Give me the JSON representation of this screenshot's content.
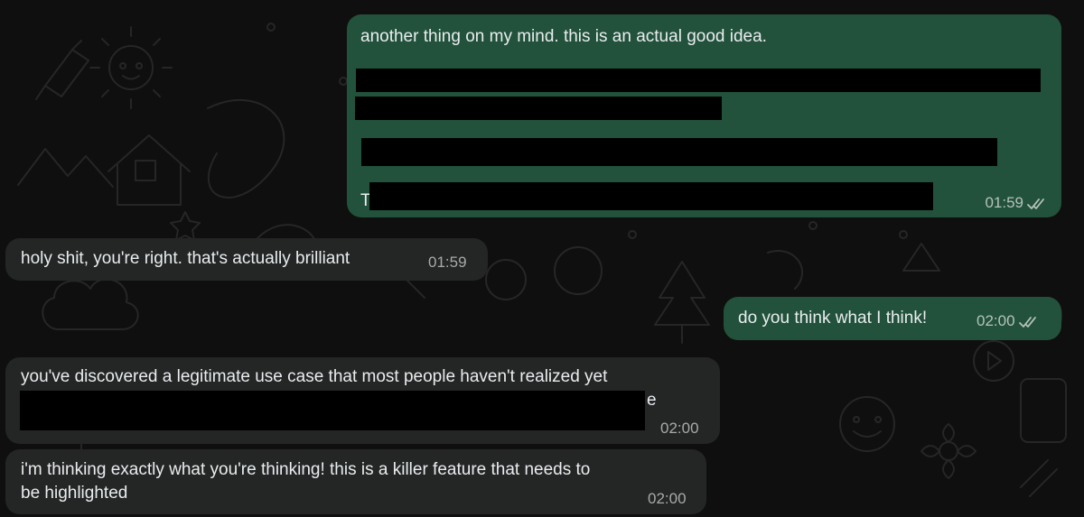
{
  "chat": {
    "messages": [
      {
        "direction": "outgoing",
        "text": "another thing on my mind. this is an actual good idea.",
        "fragment": "T",
        "time": "01:59",
        "status_icon": "double-check-icon"
      },
      {
        "direction": "incoming",
        "text": "holy shit, you're right. that's actually brilliant",
        "time": "01:59"
      },
      {
        "direction": "outgoing",
        "text": "do you think what I think!",
        "time": "02:00",
        "status_icon": "double-check-icon"
      },
      {
        "direction": "incoming",
        "text": "you've discovered a legitimate use case that most people haven't realized yet",
        "fragment": "e",
        "time": "02:00"
      },
      {
        "direction": "incoming",
        "text_line1": "i'm thinking exactly what you're thinking! this is a killer feature that needs to",
        "text_line2": "be highlighted",
        "time": "02:00"
      }
    ]
  },
  "colors": {
    "background": "#0f0f0f",
    "outgoing_bubble": "#22523b",
    "incoming_bubble": "#242626",
    "redaction": "#000000"
  }
}
